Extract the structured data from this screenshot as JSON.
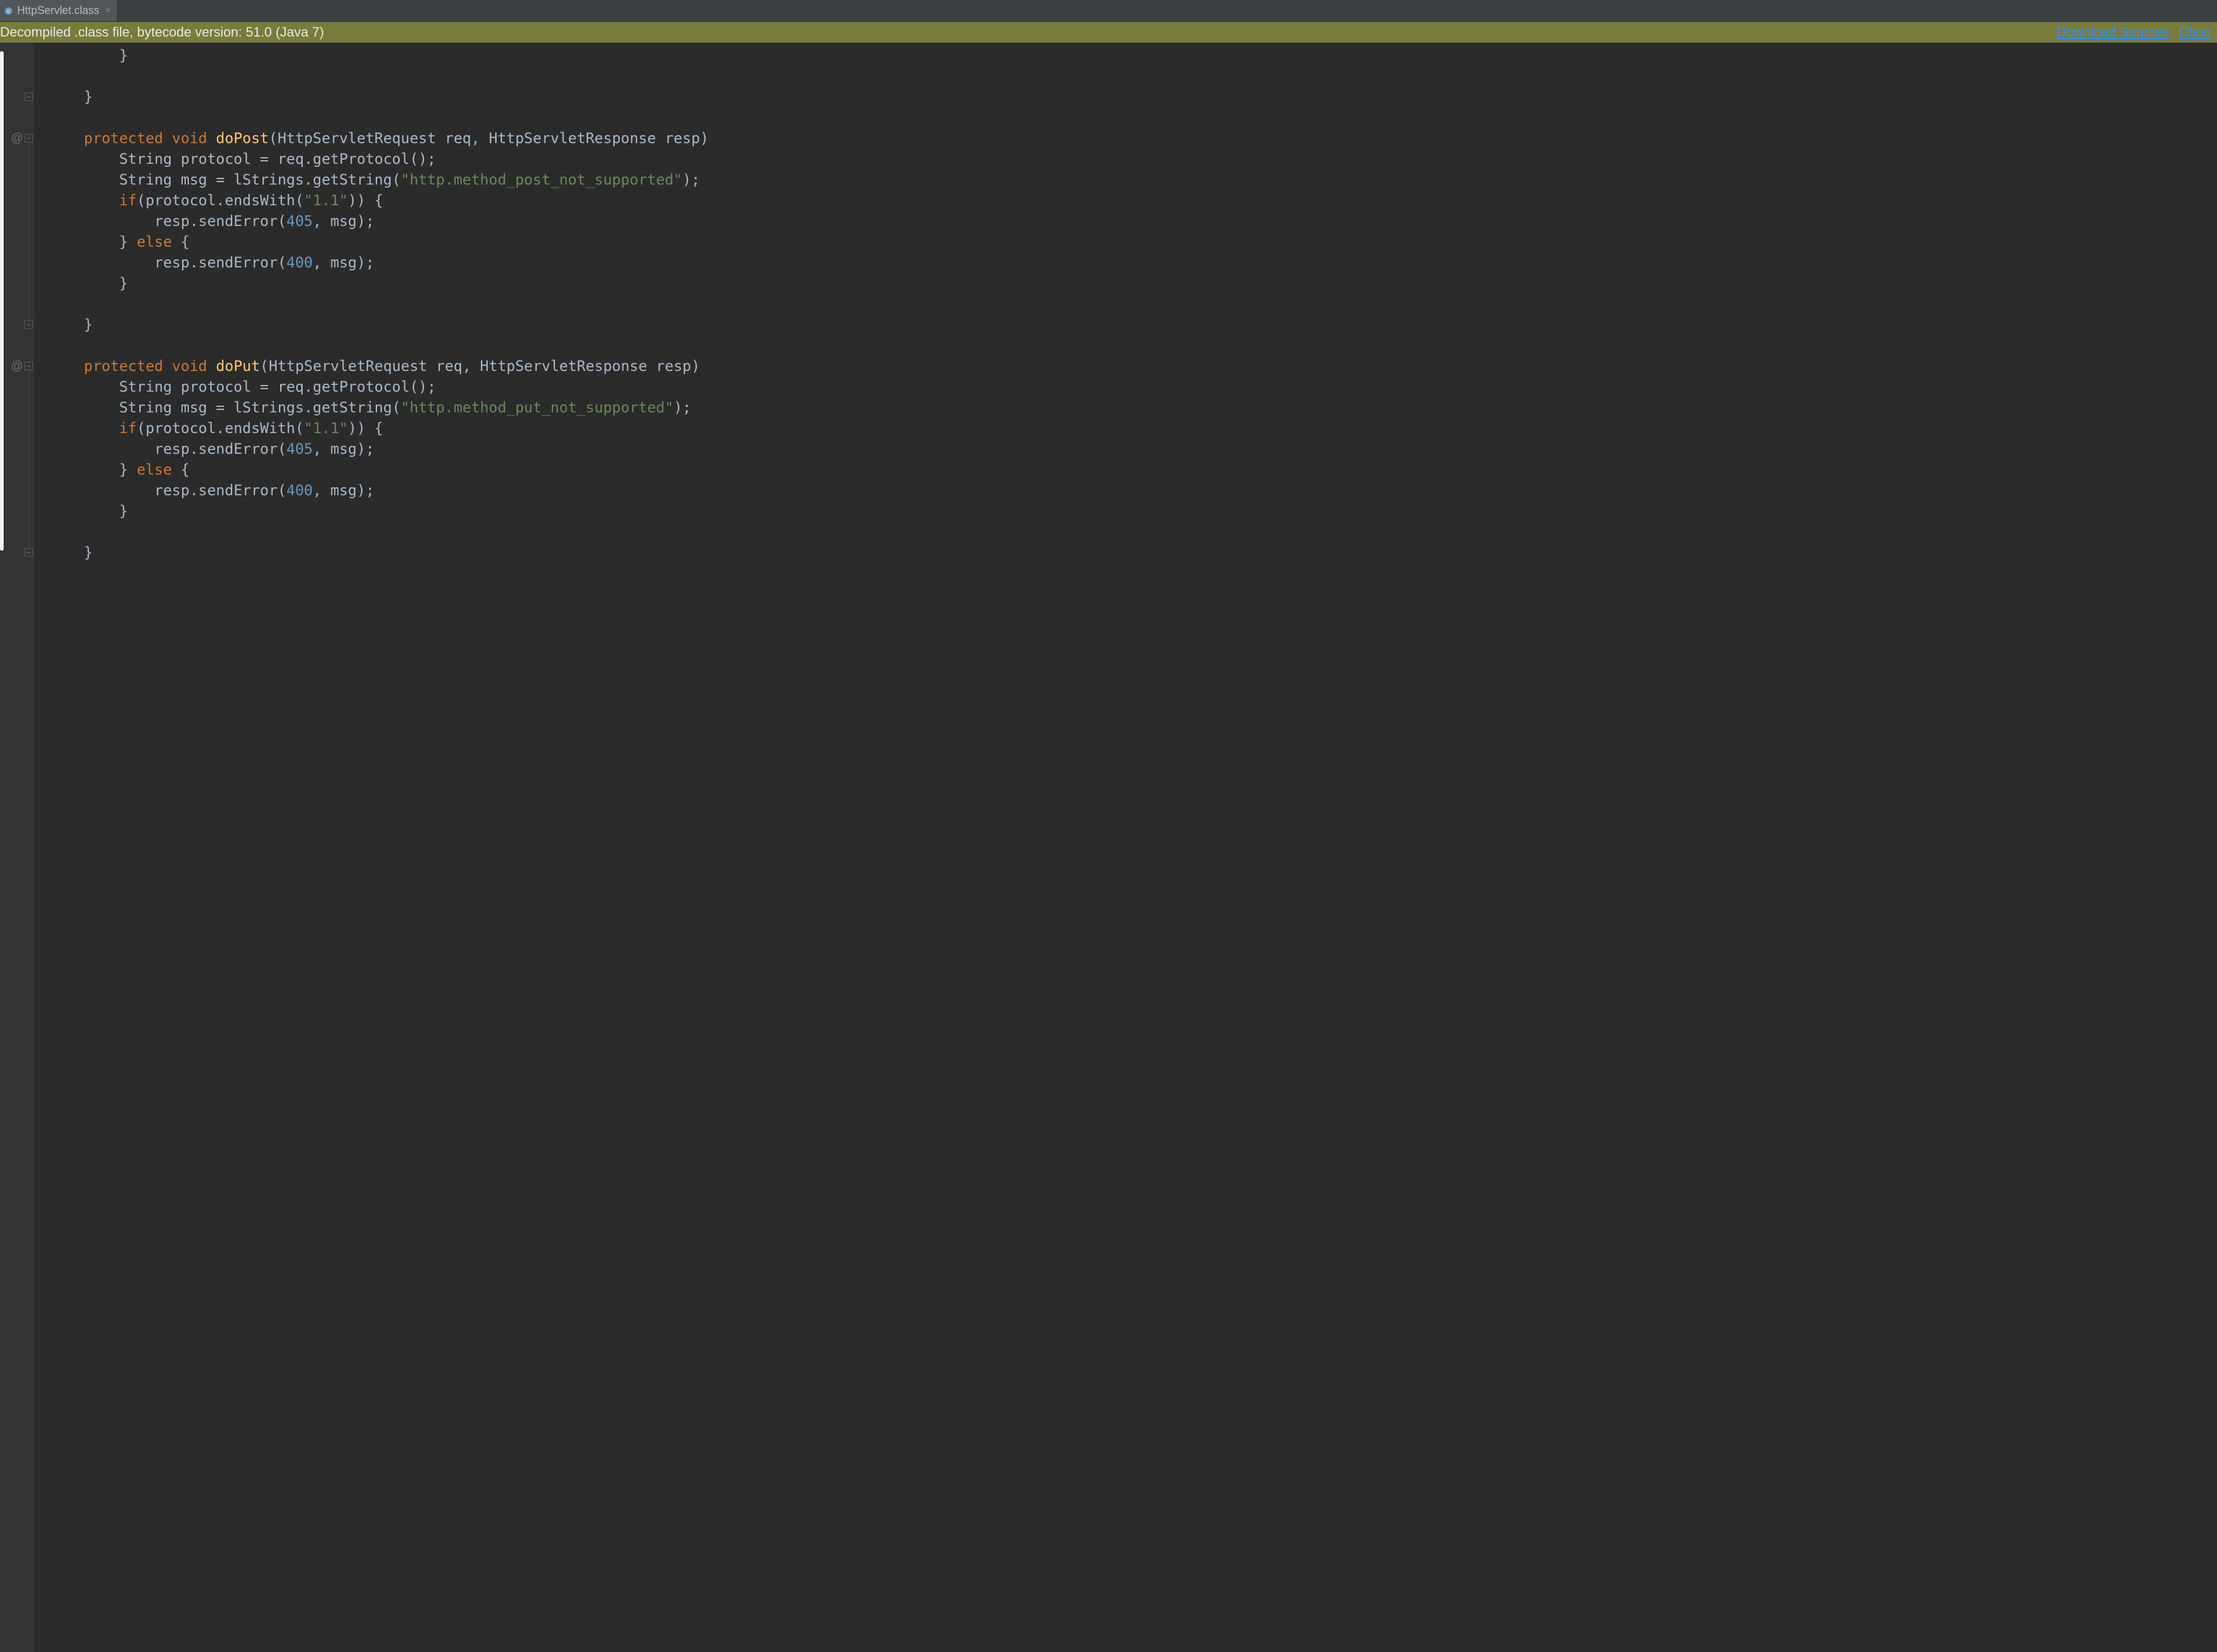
{
  "tab": {
    "filename": "HttpServlet.class"
  },
  "banner": {
    "message": "Decompiled .class file, bytecode version: 51.0 (Java 7)",
    "link1": "Download Sources",
    "link2": "Choo"
  },
  "code": {
    "lines": [
      {
        "indent": 2,
        "tokens": [
          {
            "t": "}",
            "c": "punct"
          }
        ]
      },
      {
        "indent": 0,
        "tokens": []
      },
      {
        "indent": 1,
        "tokens": [
          {
            "t": "}",
            "c": "punct"
          }
        ],
        "fold": "close"
      },
      {
        "indent": 0,
        "tokens": []
      },
      {
        "indent": 1,
        "override": true,
        "fold": "open",
        "tokens": [
          {
            "t": "protected",
            "c": "kw"
          },
          {
            "t": " ",
            "c": "whitespace"
          },
          {
            "t": "void",
            "c": "kw"
          },
          {
            "t": " ",
            "c": "whitespace"
          },
          {
            "t": "doPost",
            "c": "method-def"
          },
          {
            "t": "(",
            "c": "punct"
          },
          {
            "t": "HttpServletRequest req",
            "c": "ident"
          },
          {
            "t": ", ",
            "c": "punct"
          },
          {
            "t": "HttpServletResponse resp",
            "c": "ident"
          },
          {
            "t": ")",
            "c": "punct"
          }
        ]
      },
      {
        "indent": 2,
        "tokens": [
          {
            "t": "String protocol ",
            "c": "ident"
          },
          {
            "t": "= ",
            "c": "op"
          },
          {
            "t": "req",
            "c": "ident"
          },
          {
            "t": ".",
            "c": "punct"
          },
          {
            "t": "getProtocol",
            "c": "call"
          },
          {
            "t": "();",
            "c": "punct"
          }
        ]
      },
      {
        "indent": 2,
        "tokens": [
          {
            "t": "String msg ",
            "c": "ident"
          },
          {
            "t": "= ",
            "c": "op"
          },
          {
            "t": "lStrings",
            "c": "ident"
          },
          {
            "t": ".",
            "c": "punct"
          },
          {
            "t": "getString",
            "c": "call"
          },
          {
            "t": "(",
            "c": "punct"
          },
          {
            "t": "\"http.method_post_not_supported\"",
            "c": "str"
          },
          {
            "t": ");",
            "c": "punct"
          }
        ]
      },
      {
        "indent": 2,
        "tokens": [
          {
            "t": "if",
            "c": "kw"
          },
          {
            "t": "(",
            "c": "punct"
          },
          {
            "t": "protocol",
            "c": "ident"
          },
          {
            "t": ".",
            "c": "punct"
          },
          {
            "t": "endsWith",
            "c": "call"
          },
          {
            "t": "(",
            "c": "punct"
          },
          {
            "t": "\"1.1\"",
            "c": "str"
          },
          {
            "t": ")) {",
            "c": "punct"
          }
        ]
      },
      {
        "indent": 3,
        "tokens": [
          {
            "t": "resp",
            "c": "ident"
          },
          {
            "t": ".",
            "c": "punct"
          },
          {
            "t": "sendError",
            "c": "call"
          },
          {
            "t": "(",
            "c": "punct"
          },
          {
            "t": "405",
            "c": "num"
          },
          {
            "t": ", ",
            "c": "punct"
          },
          {
            "t": "msg",
            "c": "ident"
          },
          {
            "t": ");",
            "c": "punct"
          }
        ]
      },
      {
        "indent": 2,
        "tokens": [
          {
            "t": "} ",
            "c": "punct"
          },
          {
            "t": "else",
            "c": "kw"
          },
          {
            "t": " {",
            "c": "punct"
          }
        ]
      },
      {
        "indent": 3,
        "tokens": [
          {
            "t": "resp",
            "c": "ident"
          },
          {
            "t": ".",
            "c": "punct"
          },
          {
            "t": "sendError",
            "c": "call"
          },
          {
            "t": "(",
            "c": "punct"
          },
          {
            "t": "400",
            "c": "num"
          },
          {
            "t": ", ",
            "c": "punct"
          },
          {
            "t": "msg",
            "c": "ident"
          },
          {
            "t": ");",
            "c": "punct"
          }
        ]
      },
      {
        "indent": 2,
        "tokens": [
          {
            "t": "}",
            "c": "punct"
          }
        ]
      },
      {
        "indent": 0,
        "tokens": []
      },
      {
        "indent": 1,
        "tokens": [
          {
            "t": "}",
            "c": "punct"
          }
        ],
        "fold": "close"
      },
      {
        "indent": 0,
        "tokens": []
      },
      {
        "indent": 1,
        "override": true,
        "fold": "open",
        "tokens": [
          {
            "t": "protected",
            "c": "kw"
          },
          {
            "t": " ",
            "c": "whitespace"
          },
          {
            "t": "void",
            "c": "kw"
          },
          {
            "t": " ",
            "c": "whitespace"
          },
          {
            "t": "doPut",
            "c": "method-def"
          },
          {
            "t": "(",
            "c": "punct"
          },
          {
            "t": "HttpServletRequest req",
            "c": "ident"
          },
          {
            "t": ", ",
            "c": "punct"
          },
          {
            "t": "HttpServletResponse resp",
            "c": "ident"
          },
          {
            "t": ")",
            "c": "punct"
          }
        ]
      },
      {
        "indent": 2,
        "tokens": [
          {
            "t": "String protocol ",
            "c": "ident"
          },
          {
            "t": "= ",
            "c": "op"
          },
          {
            "t": "req",
            "c": "ident"
          },
          {
            "t": ".",
            "c": "punct"
          },
          {
            "t": "getProtocol",
            "c": "call"
          },
          {
            "t": "();",
            "c": "punct"
          }
        ]
      },
      {
        "indent": 2,
        "tokens": [
          {
            "t": "String msg ",
            "c": "ident"
          },
          {
            "t": "= ",
            "c": "op"
          },
          {
            "t": "lStrings",
            "c": "ident"
          },
          {
            "t": ".",
            "c": "punct"
          },
          {
            "t": "getString",
            "c": "call"
          },
          {
            "t": "(",
            "c": "punct"
          },
          {
            "t": "\"http.method_put_not_supported\"",
            "c": "str"
          },
          {
            "t": ");",
            "c": "punct"
          }
        ]
      },
      {
        "indent": 2,
        "tokens": [
          {
            "t": "if",
            "c": "kw"
          },
          {
            "t": "(",
            "c": "punct"
          },
          {
            "t": "protocol",
            "c": "ident"
          },
          {
            "t": ".",
            "c": "punct"
          },
          {
            "t": "endsWith",
            "c": "call"
          },
          {
            "t": "(",
            "c": "punct"
          },
          {
            "t": "\"1.1\"",
            "c": "str"
          },
          {
            "t": ")) {",
            "c": "punct"
          }
        ]
      },
      {
        "indent": 3,
        "tokens": [
          {
            "t": "resp",
            "c": "ident"
          },
          {
            "t": ".",
            "c": "punct"
          },
          {
            "t": "sendError",
            "c": "call"
          },
          {
            "t": "(",
            "c": "punct"
          },
          {
            "t": "405",
            "c": "num"
          },
          {
            "t": ", ",
            "c": "punct"
          },
          {
            "t": "msg",
            "c": "ident"
          },
          {
            "t": ");",
            "c": "punct"
          }
        ]
      },
      {
        "indent": 2,
        "tokens": [
          {
            "t": "} ",
            "c": "punct"
          },
          {
            "t": "else",
            "c": "kw"
          },
          {
            "t": " {",
            "c": "punct"
          }
        ]
      },
      {
        "indent": 3,
        "tokens": [
          {
            "t": "resp",
            "c": "ident"
          },
          {
            "t": ".",
            "c": "punct"
          },
          {
            "t": "sendError",
            "c": "call"
          },
          {
            "t": "(",
            "c": "punct"
          },
          {
            "t": "400",
            "c": "num"
          },
          {
            "t": ", ",
            "c": "punct"
          },
          {
            "t": "msg",
            "c": "ident"
          },
          {
            "t": ");",
            "c": "punct"
          }
        ]
      },
      {
        "indent": 2,
        "tokens": [
          {
            "t": "}",
            "c": "punct"
          }
        ]
      },
      {
        "indent": 0,
        "tokens": []
      },
      {
        "indent": 1,
        "tokens": [
          {
            "t": "}",
            "c": "punct"
          }
        ],
        "fold": "close"
      }
    ]
  }
}
